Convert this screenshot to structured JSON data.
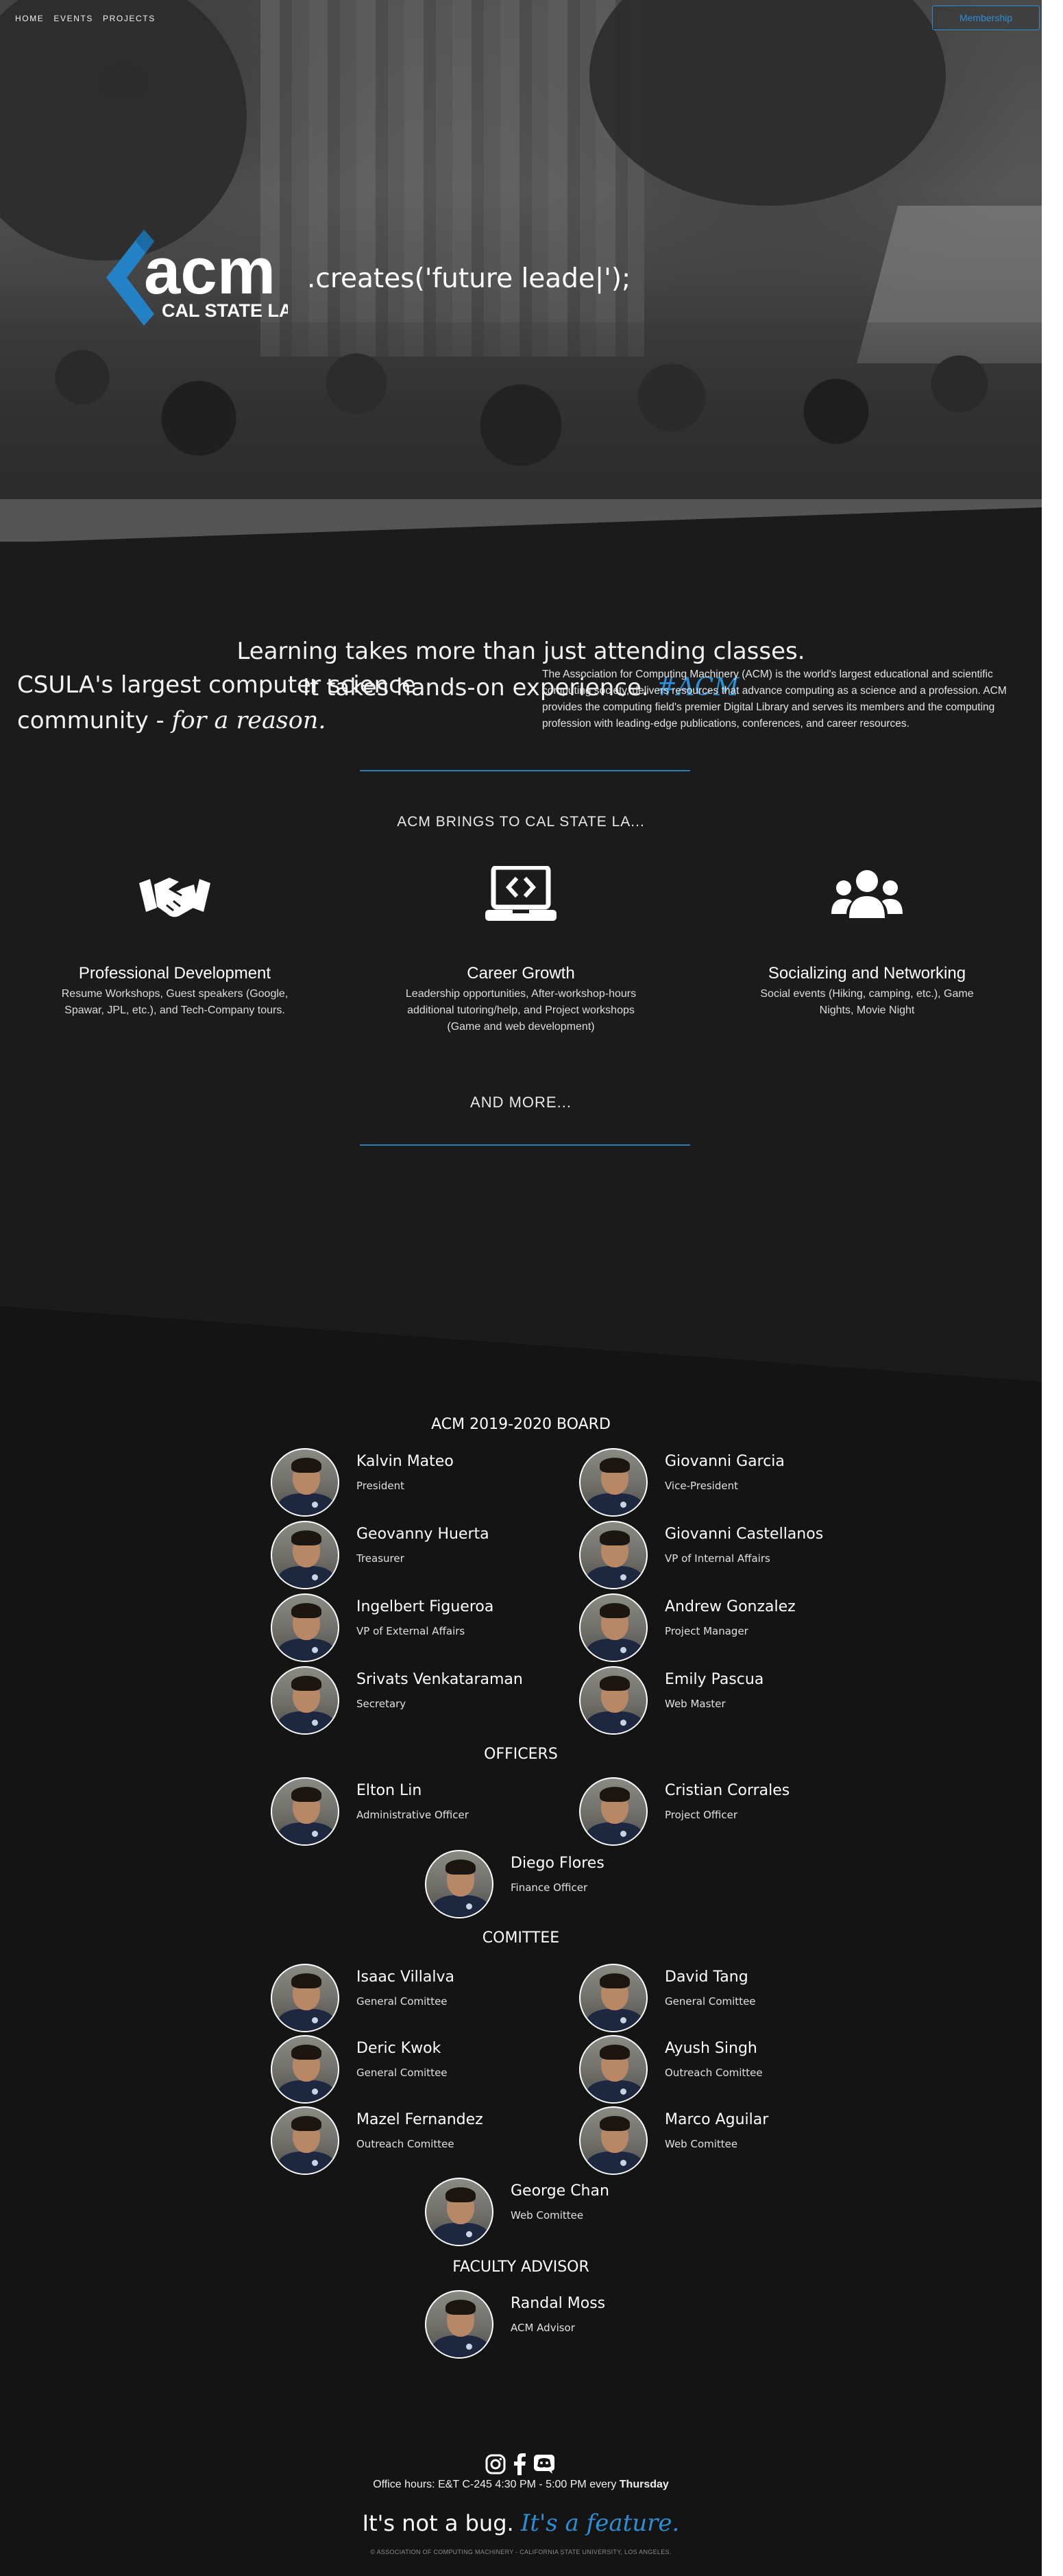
{
  "nav": {
    "items": [
      "HOME",
      "EVENTS",
      "PROJECTS"
    ],
    "membership_label": "Membership"
  },
  "hero": {
    "logo_word": "acm",
    "logo_sub": "CAL STATE LA",
    "tagline": ".creates('future leade|');"
  },
  "intro": {
    "line1": "Learning takes more than just attending classes.",
    "line2": "It takes hands-on experience.",
    "hashtag": "#ACM",
    "kicker": "ACM BRINGS TO CAL STATE LA...",
    "features": [
      {
        "icon": "handshake-icon",
        "title": "Professional Development",
        "text": "Resume Workshops, Guest speakers (Google, Spawar, JPL, etc.), and Tech-Company tours."
      },
      {
        "icon": "laptop-code-icon",
        "title": "Career Growth",
        "text": "Leadership opportunities, After-workshop-hours additional tutoring/help, and Project workshops (Game and web development)"
      },
      {
        "icon": "users-icon",
        "title": "Socializing and Networking",
        "text": "Social events (Hiking, camping, etc.), Game Nights, Movie Night"
      }
    ],
    "and_more": "AND MORE..."
  },
  "mission": {
    "line1": "CSULA's largest computer science",
    "line2": "community -",
    "reason": "for a reason.",
    "text": "The Association for Computing Machinery (ACM) is the world's largest educational and scientific computing society, delivers resources that advance computing as a science and a profession. ACM provides the computing field's premier Digital Library and serves its members and the computing profession with leading-edge publications, conferences, and career resources."
  },
  "sections": {
    "board": "ACM 2019-2020 BOARD",
    "officers": "OFFICERS",
    "committee": "COMITTEE",
    "advisor": "FACULTY ADVISOR"
  },
  "board": [
    {
      "name": "Kalvin Mateo",
      "role": "President"
    },
    {
      "name": "Giovanni Garcia",
      "role": "Vice-President"
    },
    {
      "name": "Geovanny Huerta",
      "role": "Treasurer"
    },
    {
      "name": "Giovanni Castellanos",
      "role": "VP of Internal Affairs"
    },
    {
      "name": "Ingelbert Figueroa",
      "role": "VP of External Affairs"
    },
    {
      "name": "Andrew Gonzalez",
      "role": "Project Manager"
    },
    {
      "name": "Srivats Venkataraman",
      "role": "Secretary"
    },
    {
      "name": "Emily Pascua",
      "role": "Web Master"
    }
  ],
  "officers": [
    {
      "name": "Elton Lin",
      "role": "Administrative Officer"
    },
    {
      "name": "Cristian Corrales",
      "role": "Project Officer"
    },
    {
      "name": "Diego Flores",
      "role": "Finance Officer"
    }
  ],
  "committee": [
    {
      "name": "Isaac Villalva",
      "role": "General Comittee"
    },
    {
      "name": "David Tang",
      "role": "General Comittee"
    },
    {
      "name": "Deric Kwok",
      "role": "General Comittee"
    },
    {
      "name": "Ayush Singh",
      "role": "Outreach Comittee"
    },
    {
      "name": "Mazel Fernandez",
      "role": "Outreach Comittee"
    },
    {
      "name": "Marco Aguilar",
      "role": "Web Comittee"
    },
    {
      "name": "George Chan",
      "role": "Web Comittee"
    }
  ],
  "advisor": [
    {
      "name": "Randal Moss",
      "role": "ACM Advisor"
    }
  ],
  "footer": {
    "social_icons": [
      "instagram-icon",
      "facebook-icon",
      "discord-icon"
    ],
    "hours_prefix": "Office hours: E&T C-245 4:30 PM - 5:00 PM every",
    "hours_day": "Thursday",
    "bug_text": "It's not a bug.",
    "feature_text": "It's a feature.",
    "copyright": "© ASSOCIATION OF COMPUTING MACHINERY - CALIFORNIA STATE UNIVERSITY, LOS ANGELES."
  },
  "colors": {
    "accent": "#2b8fd6",
    "background": "#1b1b1c",
    "board_bg": "#141415"
  }
}
